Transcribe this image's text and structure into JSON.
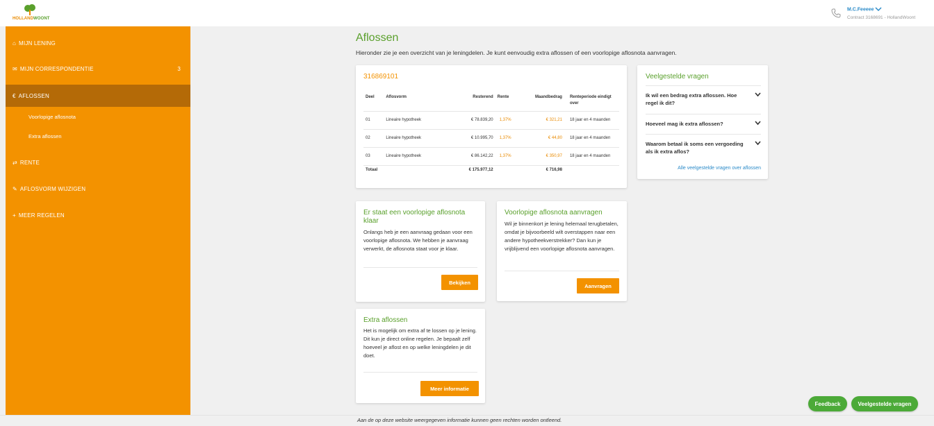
{
  "header": {
    "logo_text_a": "HOLLAND",
    "logo_text_b": "WOONT",
    "user_name": "M.C.Feeeee",
    "contract": "Contract 3168691 - HollandWoont"
  },
  "sidebar": {
    "items": [
      {
        "icon": "home",
        "label": "MIJN LENING"
      },
      {
        "icon": "mail",
        "label": "MIJN CORRESPONDENTIE",
        "badge": "3"
      },
      {
        "icon": "euro",
        "label": "AFLOSSEN"
      },
      {
        "icon": "arrows",
        "label": "RENTE"
      },
      {
        "icon": "pencil",
        "label": "AFLOSVORM WIJZIGEN"
      },
      {
        "icon": "plus",
        "label": "MEER REGELEN"
      }
    ],
    "sub_items": [
      {
        "label": "Voorlopige aflosnota"
      },
      {
        "label": "Extra aflossen"
      }
    ]
  },
  "main": {
    "title": "Aflossen",
    "intro": "Hieronder zie je een overzicht van je leningdelen. Je kunt eenvoudig extra aflossen of een voorlopige aflosnota aanvragen."
  },
  "loan": {
    "number": "316869101",
    "headers": [
      "Deel",
      "Aflosvorm",
      "Resterend",
      "Rente",
      "Maandbedrag",
      "Renteperiode eindigt over"
    ],
    "rows": [
      {
        "deel": "01",
        "aflosvorm": "Lineaire hypotheek",
        "resterend": "€ 78.839,20",
        "rente": "1,37%",
        "maandbedrag": "€ 321,21",
        "periode": "18 jaar en 4 maanden"
      },
      {
        "deel": "02",
        "aflosvorm": "Lineaire hypotheek",
        "resterend": "€ 10.995,70",
        "rente": "1,37%",
        "maandbedrag": "€ 44,80",
        "periode": "18 jaar en 4 maanden"
      },
      {
        "deel": "03",
        "aflosvorm": "Lineaire hypotheek",
        "resterend": "€ 86.142,22",
        "rente": "1,37%",
        "maandbedrag": "€ 350,97",
        "periode": "18 jaar en 4 maanden"
      }
    ],
    "total_label": "Totaal",
    "total_resterend": "€ 175.977,12",
    "total_maandbedrag": "€ 716,98"
  },
  "faq": {
    "title": "Veelgestelde vragen",
    "items": [
      {
        "question": "Ik wil een bedrag extra aflossen. Hoe regel ik dit?"
      },
      {
        "question": "Hoeveel mag ik extra aflossen?"
      },
      {
        "question": "Waarom betaal ik soms een vergoeding als ik extra aflos?"
      }
    ],
    "all_link": "Alle veelgestelde vragen over aflossen"
  },
  "cards": {
    "ready": {
      "title": "Er staat een voorlopige aflosnota klaar",
      "body": "Onlangs heb je een aanvraag gedaan voor een voorlopige aflosnota. We hebben je aanvraag verwerkt, de aflosnota staat voor je klaar.",
      "button": "Bekijken"
    },
    "request": {
      "title": "Voorlopige aflosnota aanvragen",
      "body": "Wil je binnenkort je lening helemaal terugbetalen, omdat je bijvoorbeeld wilt overstappen naar een andere hypotheekverstrekker? Dan kun je vrijblijvend een voorlopige aflosnota aanvragen.",
      "button": "Aanvragen"
    },
    "extra": {
      "title": "Extra aflossen",
      "body": "Het is mogelijk om extra af te lossen op je lening. Dit kun je direct online regelen. Je bepaalt zelf hoeveel je aflost en op welke leningdelen je dit doet.",
      "button": "Meer informatie"
    }
  },
  "floating": {
    "feedback": "Feedback",
    "faq": "Veelgestelde vragen"
  },
  "footer": {
    "text": "Aan de op deze website weergegeven informatie kunnen geen rechten worden ontleend."
  },
  "colors": {
    "orange": "#f39200",
    "orange_dark": "#b46a07",
    "green": "#5aa02c",
    "link": "#2a8ac8"
  }
}
